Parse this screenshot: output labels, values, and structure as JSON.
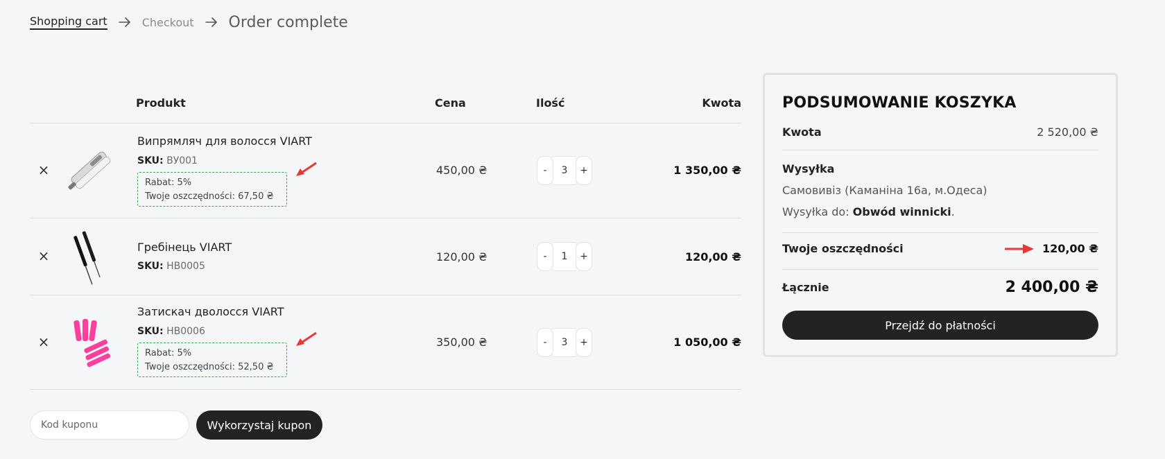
{
  "breadcrumb": {
    "step1": "Shopping cart",
    "step2": "Checkout",
    "step3": "Order complete"
  },
  "table": {
    "col_product": "Produkt",
    "col_price": "Cena",
    "col_qty": "Ilość",
    "col_amount": "Kwota"
  },
  "items": [
    {
      "name": "Випрямляч для волосся VIART",
      "sku_label": "SKU:",
      "sku": "ВУ001",
      "price": "450,00 ₴",
      "qty": "3",
      "total": "1 350,00 ₴",
      "rebate_line1": "Rabat: 5%",
      "rebate_line2": "Twoje oszczędności: 67,50 ₴",
      "image": "hair-straightener-icon"
    },
    {
      "name": "Гребінець VIART",
      "sku_label": "SKU:",
      "sku": "HB0005",
      "price": "120,00 ₴",
      "qty": "1",
      "total": "120,00 ₴",
      "image": "comb-icon"
    },
    {
      "name": "Затискач дволосся VIART",
      "sku_label": "SKU:",
      "sku": "HB0006",
      "price": "350,00 ₴",
      "qty": "3",
      "total": "1 050,00 ₴",
      "rebate_line1": "Rabat: 5%",
      "rebate_line2": "Twoje oszczędności: 52,50 ₴",
      "image": "hair-clips-icon"
    }
  ],
  "qty_minus": "-",
  "qty_plus": "+",
  "remove_symbol": "×",
  "coupon": {
    "placeholder": "Kod kuponu",
    "button": "Wykorzystaj kupon"
  },
  "summary": {
    "title": "PODSUMOWANIE KOSZYKA",
    "subtotal_label": "Kwota",
    "subtotal_value": "2 520,00 ₴",
    "shipping_label": "Wysyłka",
    "shipping_method": "Самовивіз (Каманіна 16а, м.Одеса)",
    "shipping_to_prefix": "Wysyłka do:",
    "shipping_to_region": "Obwód winnicki",
    "shipping_to_suffix": ".",
    "savings_label": "Twoje oszczędności",
    "savings_value": "120,00 ₴",
    "total_label": "Łącznie",
    "total_value": "2 400,00 ₴",
    "checkout_button": "Przejdź do płatności"
  },
  "colors": {
    "dark_button": "#232323",
    "rebate_border": "#3fa34d",
    "annotation_arrow": "#e53935",
    "clip_pink": "#ff3f9e"
  }
}
